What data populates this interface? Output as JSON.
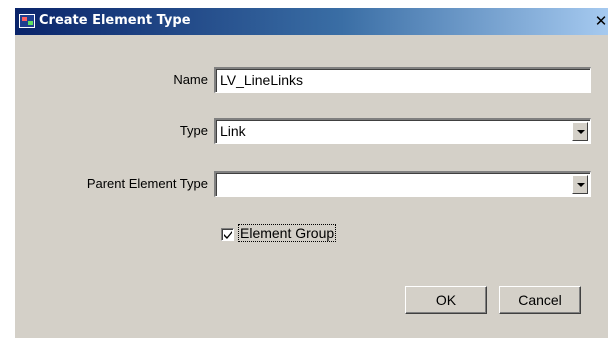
{
  "window": {
    "title": "Create Element Type",
    "close_glyph": "✕"
  },
  "form": {
    "name_label": "Name",
    "name_value": "LV_LineLinks",
    "type_label": "Type",
    "type_value": "Link",
    "parent_label": "Parent Element Type",
    "parent_value": "",
    "element_group_label": "Element Group",
    "element_group_checked": true
  },
  "buttons": {
    "ok": "OK",
    "cancel": "Cancel"
  },
  "icons": {
    "app": "create-element-type-icon",
    "close": "close-icon",
    "dropdown": "chevron-down-icon",
    "check": "check-icon"
  }
}
